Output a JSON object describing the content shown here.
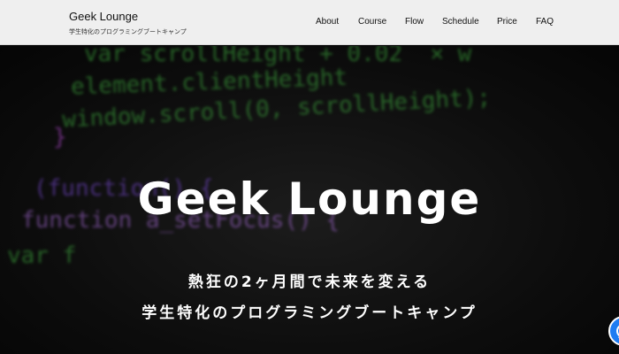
{
  "header": {
    "brand_name": "Geek Lounge",
    "brand_tagline": "学生特化のプログラミングブートキャンプ",
    "nav": [
      {
        "label": "About"
      },
      {
        "label": "Course"
      },
      {
        "label": "Flow"
      },
      {
        "label": "Schedule"
      },
      {
        "label": "Price"
      },
      {
        "label": "FAQ"
      }
    ]
  },
  "hero": {
    "title": "Geek Lounge",
    "subtitle_line1": "熱狂の2ヶ月間で未来を変える",
    "subtitle_line2": "学生特化のプログラミングブートキャンプ",
    "background_code": [
      {
        "text": "var scrollHeight + 0.02  × w",
        "color": "#3fae3f"
      },
      {
        "text": "element.clientHeight",
        "color": "#3fae3f"
      },
      {
        "text": "window.scroll(0, scrollHeight);",
        "color": "#3fae3f"
      },
      {
        "text": "}",
        "color": "#b84ad6"
      },
      {
        "text": "(function() {",
        "color": "#7a4ad6"
      },
      {
        "text": "function a_setFocus() {",
        "color": "#a66ad6"
      },
      {
        "text": "var f",
        "color": "#3fae3f"
      }
    ]
  },
  "colors": {
    "header_bg": "#efefef",
    "hero_bg": "#0d0d0d",
    "chat_button": "#1e7cf2"
  },
  "chat_widget": {
    "icon": "chat-bubble-icon"
  }
}
